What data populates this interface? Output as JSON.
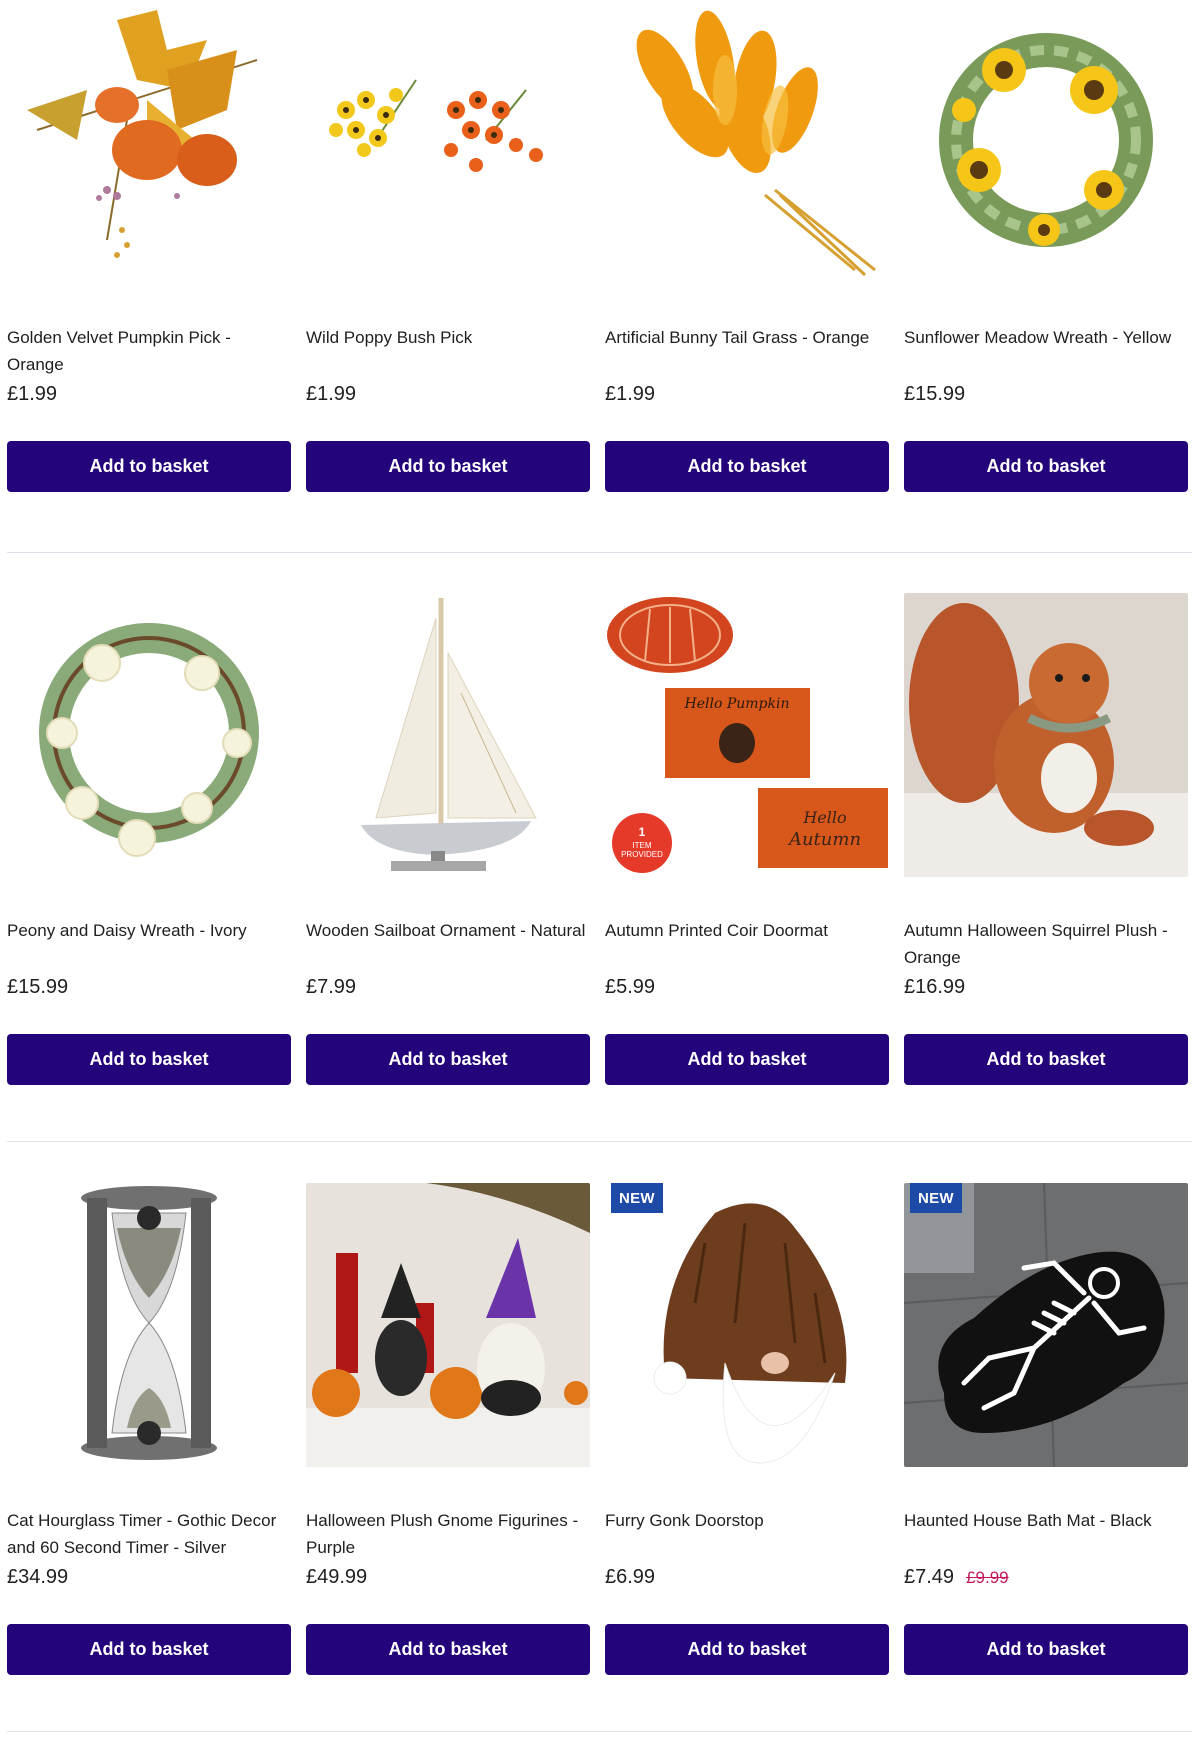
{
  "colors": {
    "button_bg": "#24047a",
    "badge_bg": "#1d4aa6",
    "sale_price": "#c2185b"
  },
  "products": [
    {
      "title": "Golden Velvet Pumpkin Pick - Orange",
      "price": "£1.99",
      "button": "Add to basket",
      "image": "pumpkin-pick"
    },
    {
      "title": "Wild Poppy Bush Pick",
      "price": "£1.99",
      "button": "Add to basket",
      "image": "poppy-pick"
    },
    {
      "title": "Artificial Bunny Tail Grass - Orange",
      "price": "£1.99",
      "button": "Add to basket",
      "image": "bunny-grass"
    },
    {
      "title": "Sunflower Meadow Wreath - Yellow",
      "price": "£15.99",
      "button": "Add to basket",
      "image": "sunflower-wreath"
    },
    {
      "title": "Peony and Daisy Wreath - Ivory",
      "price": "£15.99",
      "button": "Add to basket",
      "image": "peony-wreath"
    },
    {
      "title": "Wooden Sailboat Ornament - Natural",
      "price": "£7.99",
      "button": "Add to basket",
      "image": "sailboat"
    },
    {
      "title": "Autumn Printed Coir Doormat",
      "price": "£5.99",
      "button": "Add to basket",
      "image": "doormats",
      "image_text": {
        "mat1": "Hello Pumpkin",
        "mat2_line1": "Hello",
        "mat2_line2": "Autumn",
        "sticker_num": "1",
        "sticker_line1": "ITEM",
        "sticker_line2": "PROVIDED"
      }
    },
    {
      "title": "Autumn Halloween Squirrel Plush - Orange",
      "price": "£16.99",
      "button": "Add to basket",
      "image": "squirrel"
    },
    {
      "title": "Cat Hourglass Timer - Gothic Decor and 60 Second Timer - Silver",
      "price": "£34.99",
      "button": "Add to basket",
      "image": "hourglass"
    },
    {
      "title": "Halloween Plush Gnome Figurines - Purple",
      "price": "£49.99",
      "button": "Add to basket",
      "image": "gnomes"
    },
    {
      "title": "Furry Gonk Doorstop",
      "price": "£6.99",
      "button": "Add to basket",
      "badge": "NEW",
      "image": "gonk"
    },
    {
      "title": "Haunted House Bath Mat - Black",
      "price": "£7.49",
      "was_price": "£9.99",
      "button": "Add to basket",
      "badge": "NEW",
      "image": "skeleton-mat"
    }
  ]
}
